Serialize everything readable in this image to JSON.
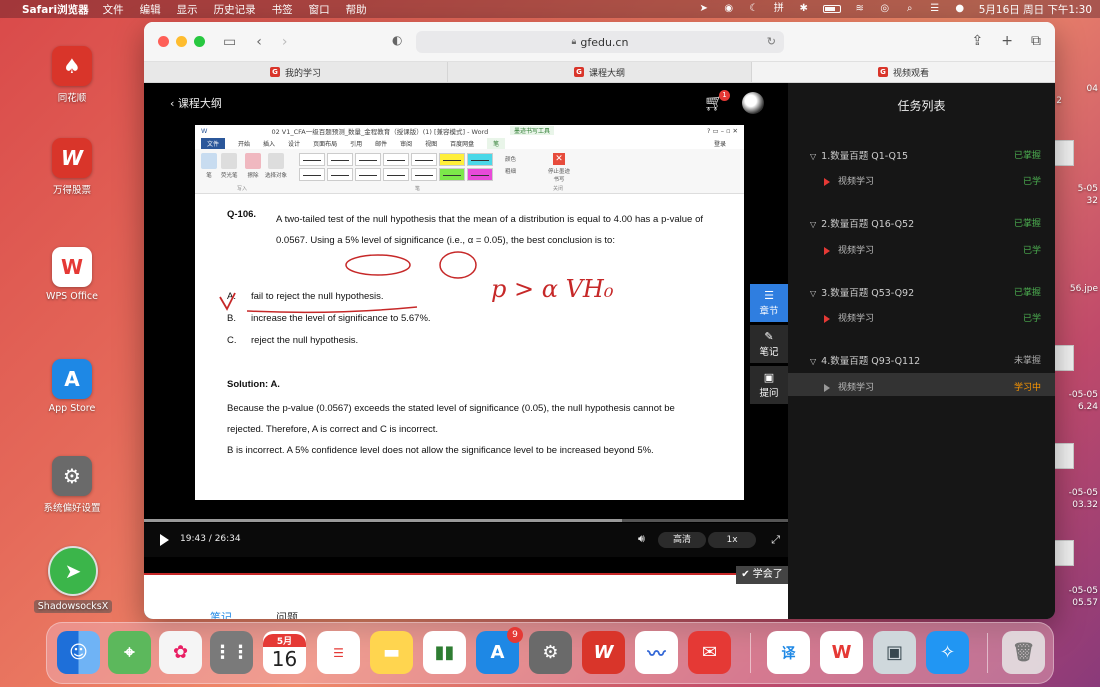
{
  "menubar": {
    "app_name": "Safari浏览器",
    "menus": [
      "文件",
      "编辑",
      "显示",
      "历史记录",
      "书签",
      "窗口",
      "帮助"
    ],
    "clock": "5月16日 周日 下午1:30"
  },
  "desktop": {
    "icons": [
      {
        "label": "同花顺",
        "color": "#d9352a",
        "glyph": "♠"
      },
      {
        "label": "万得股票",
        "color": "#d9352a",
        "glyph": "W"
      },
      {
        "label": "WPS Office",
        "color": "#ffffff",
        "glyph": "W"
      },
      {
        "label": "App Store",
        "color": "#1e88e5",
        "glyph": "A"
      },
      {
        "label": "系统偏好设置",
        "color": "#777777",
        "glyph": "⚙"
      },
      {
        "label": "ShadowsocksX",
        "color": "#3bb54a",
        "glyph": "➤"
      }
    ],
    "edge_labels": [
      "04",
      "2",
      "5-05",
      "32",
      "56.jpe",
      "-05-05",
      "6.24",
      "-05-05",
      "03.32",
      "-05-05",
      "05.57"
    ]
  },
  "browser": {
    "url": "gfedu.cn",
    "tabs": [
      "我的学习",
      "课程大纲",
      "视频观看"
    ]
  },
  "player": {
    "back_label": "课程大纲",
    "cart_count": "1",
    "time_current": "19:43",
    "time_total": "26:34",
    "time_display": "19:43 / 26:34",
    "progress": 0.742,
    "quality": "高清",
    "speed": "1x",
    "learned_button": "学会了"
  },
  "side_buttons": [
    {
      "label": "章节",
      "icon": "list-icon"
    },
    {
      "label": "笔记",
      "icon": "pencil-icon"
    },
    {
      "label": "提问",
      "icon": "question-icon"
    }
  ],
  "word": {
    "title": "02 V1_CFA一级百题预测_数量_金程教育（授课版）(1) [兼容模式] - Word",
    "context_tab": "墨迹书写工具",
    "tabs": [
      "文件",
      "开始",
      "插入",
      "设计",
      "页面布局",
      "引用",
      "邮件",
      "审阅",
      "视图",
      "百度网盘",
      "笔"
    ],
    "login": "登录",
    "tools": [
      "笔",
      "荧光笔",
      "擦除",
      "选择对象"
    ],
    "group_write": "写入",
    "group_pen": "笔",
    "group_close": "关闭",
    "color_label": "颜色",
    "thickness_label": "粗细",
    "stop_label": "停止墨迹书写"
  },
  "question": {
    "number": "Q-106.",
    "text": "A two-tailed test of the null hypothesis that the mean of a distribution is equal to 4.00 has a p-value of 0.0567. Using a 5% level of significance (i.e., α = 0.05), the best conclusion is to:",
    "options": [
      {
        "letter": "A.",
        "text": "fail to reject the null hypothesis."
      },
      {
        "letter": "B.",
        "text": "increase the level of significance to 5.67%."
      },
      {
        "letter": "C.",
        "text": "reject the null hypothesis."
      }
    ],
    "solution_title": "Solution: A.",
    "solution_text": "Because the p-value (0.0567) exceeds the stated level of significance (0.05), the null hypothesis cannot be rejected. Therefore, A is correct and C is incorrect.",
    "solution_text2": "B is incorrect. A 5% confidence level does not allow the significance level to be increased beyond 5%.",
    "handwriting": "p > α  VH₀"
  },
  "below_tabs": [
    "笔记",
    "问题"
  ],
  "task_panel": {
    "title": "任务列表",
    "chapters": [
      {
        "name": "1.数量百题 Q1-Q15",
        "status": "已掌握",
        "status_color": "#4caf50",
        "lesson": "视频学习",
        "lesson_status": "已学",
        "lesson_color": "#4caf50"
      },
      {
        "name": "2.数量百题 Q16-Q52",
        "status": "已掌握",
        "status_color": "#4caf50",
        "lesson": "视频学习",
        "lesson_status": "已学",
        "lesson_color": "#4caf50"
      },
      {
        "name": "3.数量百题 Q53-Q92",
        "status": "已掌握",
        "status_color": "#4caf50",
        "lesson": "视频学习",
        "lesson_status": "已学",
        "lesson_color": "#4caf50"
      },
      {
        "name": "4.数量百题 Q93-Q112",
        "status": "未掌握",
        "status_color": "#aaaaaa",
        "lesson": "视频学习",
        "lesson_status": "学习中",
        "lesson_color": "#ff9800"
      }
    ]
  },
  "dock": {
    "calendar_month": "5月",
    "calendar_day": "16",
    "appstore_badge": "9",
    "apps": [
      {
        "name": "finder",
        "color": "#3d8ef0"
      },
      {
        "name": "maps",
        "color": "#5cb85c"
      },
      {
        "name": "photos",
        "color": "#f5f5f5"
      },
      {
        "name": "launchpad",
        "color": "#7a7a7a"
      },
      {
        "name": "calendar",
        "color": "#ffffff"
      },
      {
        "name": "reminders",
        "color": "#ffffff"
      },
      {
        "name": "notes",
        "color": "#ffd54f"
      },
      {
        "name": "numbers",
        "color": "#ffffff"
      },
      {
        "name": "app-store",
        "color": "#1e88e5"
      },
      {
        "name": "system-preferences",
        "color": "#6a6a6a"
      },
      {
        "name": "wind",
        "color": "#d9352a"
      },
      {
        "name": "lark",
        "color": "#ffffff"
      },
      {
        "name": "mail",
        "color": "#e53935"
      },
      {
        "name": "translate",
        "color": "#ffffff"
      },
      {
        "name": "wps",
        "color": "#ffffff"
      },
      {
        "name": "preview",
        "color": "#cfd8dc"
      },
      {
        "name": "safari",
        "color": "#2196f3"
      },
      {
        "name": "trash",
        "color": "#e0e0e0"
      }
    ]
  }
}
